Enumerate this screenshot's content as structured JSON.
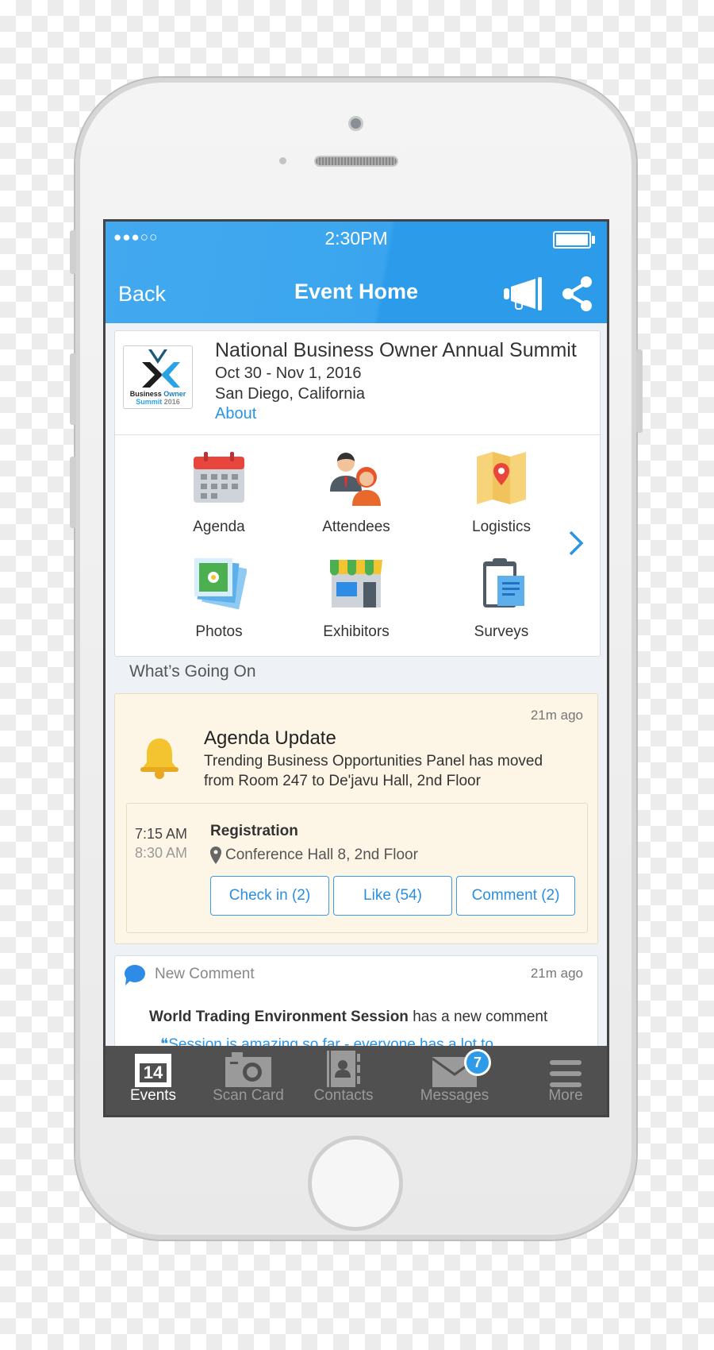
{
  "status": {
    "time": "2:30PM",
    "signal": "●●●○○"
  },
  "nav": {
    "back": "Back",
    "title": "Event Home"
  },
  "event": {
    "logo_line1a": "Business",
    "logo_line1b": "Owner",
    "logo_line2a": "Summit",
    "logo_line2b": "2016",
    "title": "National Business Owner Annual Summit",
    "dates": "Oct 30 - Nov 1, 2016",
    "location": "San Diego, California",
    "about": "About"
  },
  "tiles": [
    {
      "label": "Agenda"
    },
    {
      "label": "Attendees"
    },
    {
      "label": "Logistics"
    },
    {
      "label": "Photos"
    },
    {
      "label": "Exhibitors"
    },
    {
      "label": "Surveys"
    }
  ],
  "section_title": "What’s Going On",
  "update": {
    "time": "21m ago",
    "title": "Agenda Update",
    "line1": "Trending Business Opportunities Panel has moved",
    "line2": "from Room 247 to De'javu Hall, 2nd Floor",
    "session": {
      "start": "7:15 AM",
      "end": "8:30 AM",
      "name": "Registration",
      "place": "Conference Hall 8, 2nd Floor",
      "buttons": [
        "Check in (2)",
        "Like (54)",
        "Comment (2)"
      ]
    }
  },
  "comment": {
    "label": "New Comment",
    "time": "21m ago",
    "session": "World Trading Environment Session",
    "suffix": " has a new comment",
    "quote": "Session is amazing so far - everyone has a lot to"
  },
  "tabbar": {
    "items": [
      {
        "label": "Events",
        "icon_text": "14"
      },
      {
        "label": "Scan Card"
      },
      {
        "label": "Contacts"
      },
      {
        "label": "Messages",
        "badge": "7"
      },
      {
        "label": "More"
      }
    ]
  },
  "colors": {
    "accent": "#3aa5ee",
    "tabbar": "#505050",
    "update_bg": "#fdf6e6",
    "badge": "#2e9be8"
  }
}
